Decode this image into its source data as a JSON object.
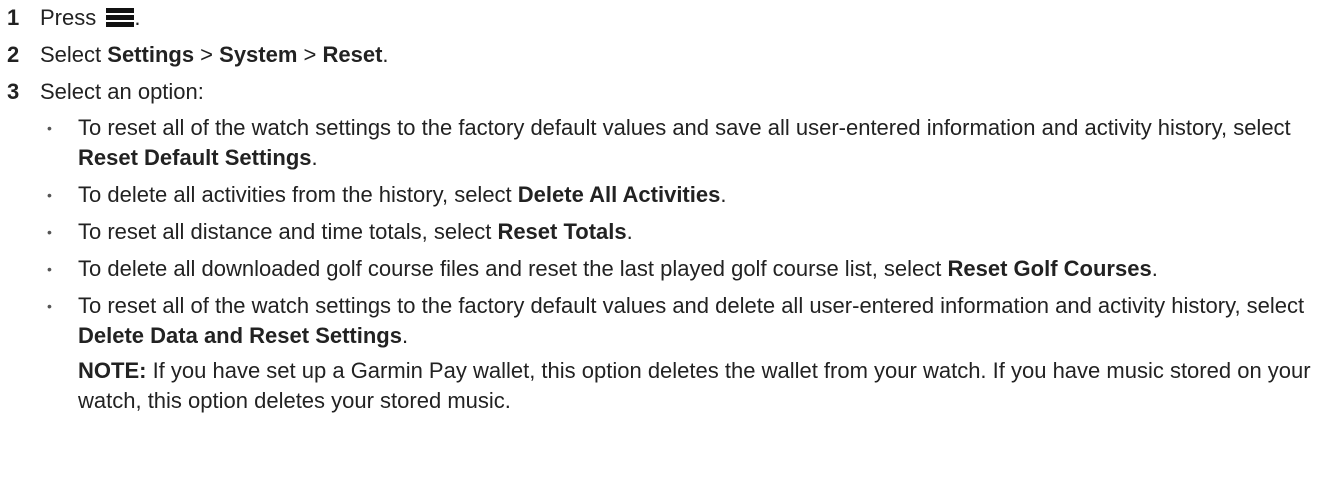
{
  "steps": [
    {
      "number": "1",
      "text_before": "Press",
      "icon": "menu-icon",
      "text_after": "."
    },
    {
      "number": "2",
      "text_before": "Select ",
      "menu_path": [
        "Settings",
        "System",
        "Reset"
      ],
      "separator": " > ",
      "text_after": "."
    },
    {
      "number": "3",
      "text": "Select an option:",
      "options": [
        {
          "text": "To reset all of the watch settings to the factory default values and save all user-entered information and activity history, select ",
          "bold": "Reset Default Settings",
          "end": "."
        },
        {
          "text": "To delete all activities from the history, select ",
          "bold": "Delete All Activities",
          "end": "."
        },
        {
          "text": "To reset all distance and time totals, select ",
          "bold": "Reset Totals",
          "end": "."
        },
        {
          "text": "To delete all downloaded golf course files and reset the last played golf course list, select ",
          "bold": "Reset Golf Courses",
          "end": "."
        },
        {
          "text": "To reset all of the watch settings to the factory default values and delete all user-entered information and activity history, select ",
          "bold": "Delete Data and Reset Settings",
          "end": "."
        }
      ],
      "note_label": "NOTE:",
      "note_text": " If you have set up a Garmin Pay wallet, this option deletes the wallet from your watch. If you have music stored on your watch, this option deletes your stored music."
    }
  ]
}
